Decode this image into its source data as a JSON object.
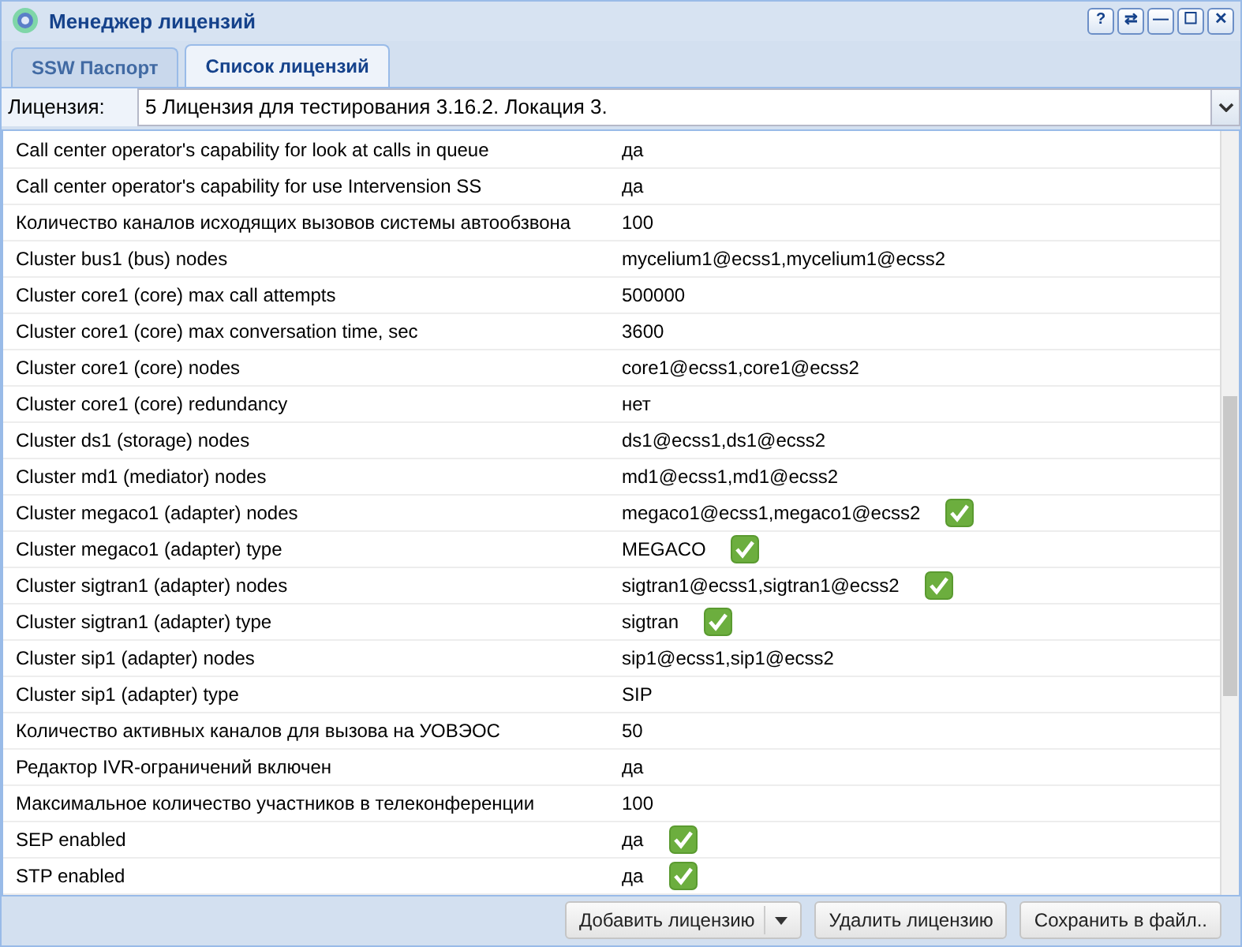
{
  "window": {
    "title": "Менеджер лицензий",
    "controls": [
      "?",
      "⇄",
      "—",
      "☐",
      "✕"
    ]
  },
  "tabs": [
    {
      "label": "SSW Паспорт",
      "selected": false
    },
    {
      "label": "Список лицензий",
      "selected": true
    }
  ],
  "license": {
    "label": "Лицензия:",
    "value": "5 Лицензия для тестирования 3.16.2. Локация 3."
  },
  "rows": [
    {
      "name": "Call center operator's capability for look at calls in queue",
      "value": "да",
      "verified": false
    },
    {
      "name": "Call center operator's capability for use Intervension SS",
      "value": "да",
      "verified": false
    },
    {
      "name": "Количество каналов исходящих вызовов системы автообзвона",
      "value": "100",
      "verified": false
    },
    {
      "name": "Cluster bus1 (bus) nodes",
      "value": "mycelium1@ecss1,mycelium1@ecss2",
      "verified": false
    },
    {
      "name": "Cluster core1 (core) max call attempts",
      "value": "500000",
      "verified": false
    },
    {
      "name": "Cluster core1 (core) max conversation time, sec",
      "value": "3600",
      "verified": false
    },
    {
      "name": "Cluster core1 (core) nodes",
      "value": "core1@ecss1,core1@ecss2",
      "verified": false
    },
    {
      "name": "Cluster core1 (core) redundancy",
      "value": "нет",
      "verified": false
    },
    {
      "name": "Cluster ds1 (storage) nodes",
      "value": "ds1@ecss1,ds1@ecss2",
      "verified": false
    },
    {
      "name": "Cluster md1 (mediator) nodes",
      "value": "md1@ecss1,md1@ecss2",
      "verified": false
    },
    {
      "name": "Cluster megaco1 (adapter) nodes",
      "value": "megaco1@ecss1,megaco1@ecss2",
      "verified": true
    },
    {
      "name": "Cluster megaco1 (adapter) type",
      "value": "MEGACO",
      "verified": true
    },
    {
      "name": "Cluster sigtran1 (adapter) nodes",
      "value": "sigtran1@ecss1,sigtran1@ecss2",
      "verified": true
    },
    {
      "name": "Cluster sigtran1 (adapter) type",
      "value": "sigtran",
      "verified": true
    },
    {
      "name": "Cluster sip1 (adapter) nodes",
      "value": "sip1@ecss1,sip1@ecss2",
      "verified": false
    },
    {
      "name": "Cluster sip1 (adapter) type",
      "value": "SIP",
      "verified": false
    },
    {
      "name": "Количество активных каналов для вызова на УОВЭОС",
      "value": "50",
      "verified": false
    },
    {
      "name": "Редактор IVR-ограничений включен",
      "value": "да",
      "verified": false
    },
    {
      "name": "Максимальное количество участников в телеконференции",
      "value": "100",
      "verified": false
    },
    {
      "name": "SEP enabled",
      "value": "да",
      "verified": true
    },
    {
      "name": "STP enabled",
      "value": "да",
      "verified": true
    }
  ],
  "buttons": [
    {
      "label": "Добавить лицензию",
      "kind": "split"
    },
    {
      "label": "Удалить лицензию",
      "kind": "plain"
    },
    {
      "label": "Сохранить в файл..",
      "kind": "plain"
    }
  ]
}
